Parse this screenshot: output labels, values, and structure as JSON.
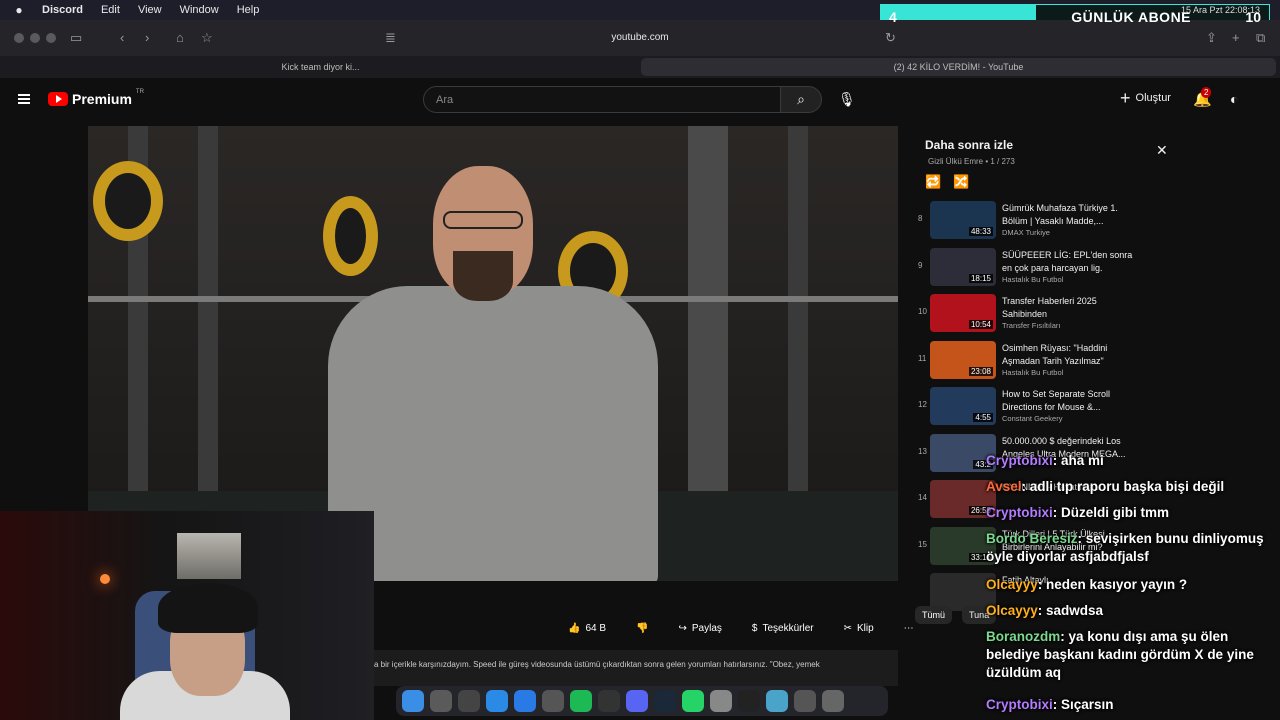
{
  "menubar": {
    "app": "Discord",
    "items": [
      "Edit",
      "View",
      "Window",
      "Help"
    ]
  },
  "sub_counter": {
    "left": "4",
    "label": "GÜNLÜK ABONE",
    "right": "10",
    "date": "15 Ara Pzt  22:08:13"
  },
  "browser": {
    "url": "youtube.com",
    "tabs": [
      "Kick team diyor ki...",
      "(2) 42 KİLO VERDİM! - YouTube"
    ]
  },
  "youtube": {
    "logo": "Premium",
    "logo_region": "TR",
    "search_placeholder": "Ara",
    "create_label": "Oluştur",
    "notifications": "2",
    "actions": {
      "likes": "64 B",
      "share": "Paylaş",
      "thanks": "Teşekkürler",
      "clip": "Klip"
    },
    "description": "a bir içerikle karşınızdayım. Speed ile güreş videosunda üstümü çıkardıktan sonra gelen yorumları hatırlarsınız. \"Obez, yemek",
    "playlist": {
      "title": "Daha sonra izle",
      "sub": "Gizli  Ülkü Emre  •  1 / 273",
      "items": [
        {
          "idx": "8",
          "title": "Gümrük Muhafaza Türkiye 1. Bölüm | Yasaklı Madde,...",
          "channel": "DMAX Turkiye",
          "dur": "48:33",
          "color": "#1b3550"
        },
        {
          "idx": "9",
          "title": "SÜÜPEEER LİG: EPL'den sonra en çok para harcayan lig.",
          "channel": "Hastalık Bu Futbol",
          "dur": "18:15",
          "color": "#2d2d3a"
        },
        {
          "idx": "10",
          "title": "Transfer Haberleri 2025 Sahibinden",
          "channel": "Transfer Fısıltıları",
          "dur": "10:54",
          "color": "#b1121b"
        },
        {
          "idx": "11",
          "title": "Osimhen Rüyası: \"Haddini Aşmadan Tarih Yazılmaz\"",
          "channel": "Hastalık Bu Futbol",
          "dur": "23:08",
          "color": "#c4541a"
        },
        {
          "idx": "12",
          "title": "How to Set Separate Scroll Directions for Mouse &...",
          "channel": "Constant Geekery",
          "dur": "4:55",
          "color": "#223a5c"
        },
        {
          "idx": "13",
          "title": "50.000.000 $ değerindeki Los Angeles Ultra Modern MEGA...",
          "channel": "",
          "dur": "43:2",
          "color": "#3a4a66"
        },
        {
          "idx": "14",
          "title": "OYUNLAR - Hayatımla...",
          "channel": "",
          "dur": "26:59",
          "color": "#6a2a2a"
        },
        {
          "idx": "15",
          "title": "Türk Dilleri | 5 Türk Ülkesi Birbirlerini Anlayabilir mi?",
          "channel": "",
          "dur": "33:16",
          "color": "#2a3a2a"
        },
        {
          "idx": "",
          "title": "Fatih Altaylı",
          "channel": "",
          "dur": "",
          "color": "#2a2a2a"
        }
      ]
    },
    "chips": [
      "Tümü",
      "Tuna"
    ]
  },
  "chat": [
    {
      "user": "Cryptobixi",
      "text": ": aha  mi",
      "color": "purple"
    },
    {
      "user": "Avsel",
      "text": ": adli tıp raporu başka bişi değil",
      "color": "orange"
    },
    {
      "user": "Cryptobixi",
      "text": ": Düzeldi gibi tmm",
      "color": "purple"
    },
    {
      "user": "Bordo Beresiz",
      "text": ": sevişirken bunu dinliyomuş öyle diyorlar asfjabdfjalsf",
      "color": "green"
    },
    {
      "user": "Olcayyy",
      "text": ": neden kasıyor yayın ?",
      "color": "yellow"
    },
    {
      "user": "Olcayyy",
      "text": ": sadwdsa",
      "color": "yellow"
    },
    {
      "user": "Boranozdm",
      "text": ": ya konu dışı ama şu ölen belediye başkanı kadını gördüm X de yine üzüldüm aq",
      "color": "green"
    },
    {
      "user": "Cryptobixi",
      "text": ": Sıçarsın",
      "color": "purple"
    }
  ],
  "dock_icons": [
    "finder-icon",
    "chrome-icon",
    "launchpad-icon",
    "safari-icon",
    "appstore-icon",
    "obs-icon",
    "spotify-icon",
    "notion-icon",
    "discord-icon",
    "steam-icon",
    "whatsapp-icon",
    "files-icon",
    "terminal-icon",
    "folder-icon",
    "screenshot-icon",
    "trash-icon"
  ]
}
